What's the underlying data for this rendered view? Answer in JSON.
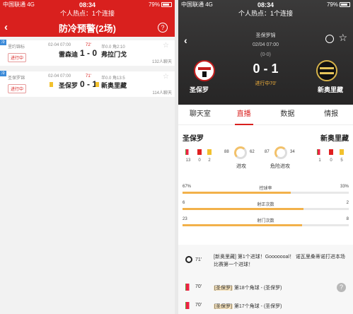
{
  "status_left": {
    "carrier": "中国联通",
    "network": "4G",
    "time": "08:34",
    "battery": "79%"
  },
  "status_right": {
    "carrier": "中国联通",
    "network": "4G",
    "time": "08:34",
    "battery": "79%"
  },
  "hotbar_text": "个人热点：1个连接",
  "left": {
    "title": "防冷预警(2场)",
    "matches": [
      {
        "corner": "冷",
        "league": "里约锦标",
        "phase": "进行中",
        "date": "02-04 07:00",
        "minute": "72'",
        "odds": "半0.0 角2:10",
        "home": "雷森迪",
        "score": "1 - 0",
        "away": "弗拉门戈",
        "chat": "132人聊天"
      },
      {
        "corner": "冷",
        "league": "圣保罗锦",
        "phase": "进行中",
        "date": "02-04 07:00",
        "minute": "71'",
        "odds": "半0.0 角13:5",
        "home": "圣保罗",
        "score": "0 - 1",
        "away": "新奥里藏",
        "chat": "114人聊天"
      }
    ]
  },
  "right": {
    "league": "圣保罗锦",
    "date": "02/04 07:00",
    "halftime": "(0-0)",
    "score": "0 - 1",
    "status": "进行中70'",
    "home": "圣保罗",
    "away": "新奥里藏",
    "tabs": [
      "聊天室",
      "直播",
      "数据",
      "情报"
    ],
    "active_tab": 1,
    "stats": {
      "home_counts": [
        "13",
        "0",
        "2"
      ],
      "away_counts": [
        "1",
        "0",
        "5"
      ],
      "attack_home": "88",
      "attack_away": "62",
      "attack_label": "进攻",
      "danger_home": "87",
      "danger_away": "34",
      "danger_label": "危险进攻",
      "bars": [
        {
          "label": "控球率",
          "home": "67%",
          "away": "33%",
          "home_frac": 0.67
        },
        {
          "label": "射正次数",
          "home": "6",
          "away": "2",
          "home_frac": 0.75
        },
        {
          "label": "射门次数",
          "home": "23",
          "away": "8",
          "home_frac": 0.74
        }
      ]
    },
    "events": [
      {
        "icon": "football-icon",
        "minute": "71'",
        "prefix": "[新奥里藏]",
        "text": " 第1个进球！Gooooooal！ 诺瓦里桑蒂诺打进本场比赛第一个进球！"
      },
      {
        "icon": "corner-flag-icon",
        "minute": "70'",
        "prefix": "[圣保罗]",
        "text": " 第18个角球 - (圣保罗)"
      },
      {
        "icon": "corner-flag-icon",
        "minute": "70'",
        "prefix": "[圣保罗]",
        "text": " 第17个角球 - (圣保罗)"
      }
    ],
    "colors": {
      "accent": "#d9201e",
      "bar": "#f2b14a",
      "highlight": "#f7e3bc"
    }
  }
}
